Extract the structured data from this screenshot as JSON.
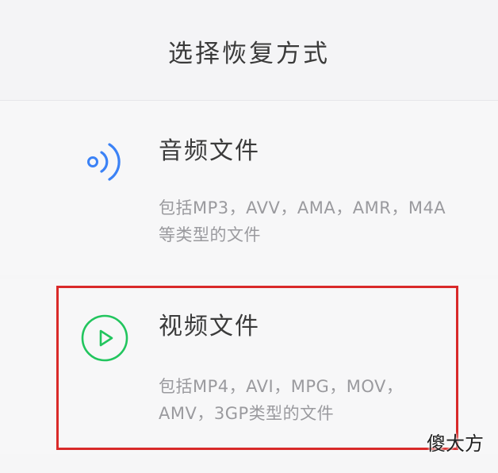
{
  "header": {
    "title": "选择恢复方式"
  },
  "options": [
    {
      "id": "audio",
      "icon": "audio-wave-icon",
      "title": "音频文件",
      "description": "包括MP3，AVV，AMA，AMR，M4A等类型的文件",
      "icon_color": "#3b82f6"
    },
    {
      "id": "video",
      "icon": "play-circle-icon",
      "title": "视频文件",
      "description": "包括MP4，AVI，MPG，MOV，AMV，3GP类型的文件",
      "icon_color": "#22c55e"
    }
  ],
  "highlight": {
    "color": "#d92a2a"
  },
  "watermark": {
    "text": "傻大方"
  }
}
